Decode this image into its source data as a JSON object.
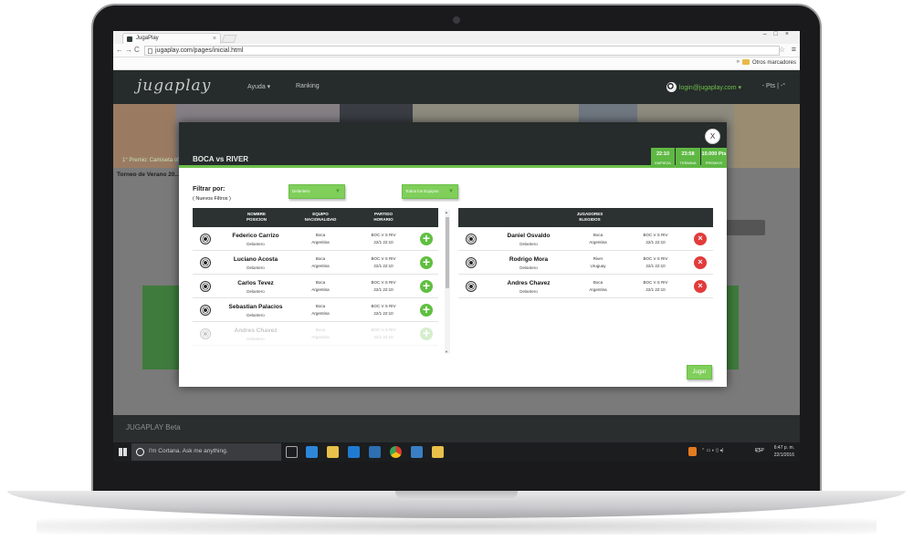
{
  "browser": {
    "tab_title": "JugaPlay",
    "tab_close": "×",
    "url": "jugaplay.com/pages/inicial.html",
    "nav_back": "←",
    "nav_forward": "→",
    "nav_reload": "C",
    "window_controls": "–□×",
    "bookmarks_label": "Otros marcadores",
    "bookmarks_arrow": "»"
  },
  "site": {
    "logo": "jugaplay",
    "nav": [
      "Ayuda ▾",
      "Ranking"
    ],
    "user_email": "login@jugaplay.com ▾",
    "points": "- Pts | -°",
    "banner_prize": "1° Premio: Camiseta ofi...",
    "torneo": "Torneo de Verano 20...",
    "footer": "JUGAPLAY Beta"
  },
  "modal": {
    "title": "BOCA vs RIVER",
    "close": "X",
    "badges": [
      {
        "value": "22:10",
        "label": "EMPIEZA"
      },
      {
        "value": "23:58",
        "label": "TERMINA"
      },
      {
        "value": "10.000 Pts",
        "label": "PREMIOS"
      }
    ],
    "filter_label": "Filtrar por:",
    "filter_sub": "( Nuevos Filtros )",
    "filter_position": "Delantero",
    "filter_team": "Todos los Equipos",
    "left_headers": [
      "NOMBRE\nPOSICION",
      "EQUIPO\nNACIONALIDAD",
      "PARTIDO\nHORARIO"
    ],
    "right_header": "JUGADORES\nELEGIDOS",
    "available": [
      {
        "name": "Federico Carrizo",
        "pos": "Delantero",
        "team": "Boca",
        "nat": "Argentina",
        "match": "BOC V S RIV",
        "time": "22/1 22:10"
      },
      {
        "name": "Luciano Acosta",
        "pos": "Delantero",
        "team": "Boca",
        "nat": "Argentina",
        "match": "BOC V S RIV",
        "time": "22/1 22:10"
      },
      {
        "name": "Carlos Tevez",
        "pos": "Delantero",
        "team": "Boca",
        "nat": "Argentina",
        "match": "BOC V S RIV",
        "time": "22/1 22:10"
      },
      {
        "name": "Sebastian Palacios",
        "pos": "Delantero",
        "team": "Boca",
        "nat": "Argentina",
        "match": "BOC V S RIV",
        "time": "22/1 22:10"
      },
      {
        "name": "Andres Chavez",
        "pos": "Delantero",
        "team": "Boca",
        "nat": "Argentina",
        "match": "BOC V S RIV",
        "time": "22/1 22:10"
      }
    ],
    "selected": [
      {
        "name": "Daniel Osvaldo",
        "pos": "Delantero",
        "team": "Boca",
        "nat": "Argentina",
        "match": "BOC V S RIV",
        "time": "22/1 22:10"
      },
      {
        "name": "Rodrigo Mora",
        "pos": "Delantero",
        "team": "River",
        "nat": "Uruguay",
        "match": "BOC V S RIV",
        "time": "22/1 22:10"
      },
      {
        "name": "Andres Chavez",
        "pos": "Delantero",
        "team": "Boca",
        "nat": "Argentina",
        "match": "BOC V S RIV",
        "time": "22/1 22:10"
      }
    ],
    "add_icon": "+",
    "remove_icon": "×",
    "play": "Jugar"
  },
  "taskbar": {
    "cortana": "I'm Cortana. Ask me anything.",
    "language": "ESP",
    "time": "6:47 p. m.",
    "date": "22/1/2016"
  },
  "colors": {
    "accent_green": "#6cc04a",
    "header_dark": "#262b2b",
    "remove_red": "#e23b3b"
  }
}
